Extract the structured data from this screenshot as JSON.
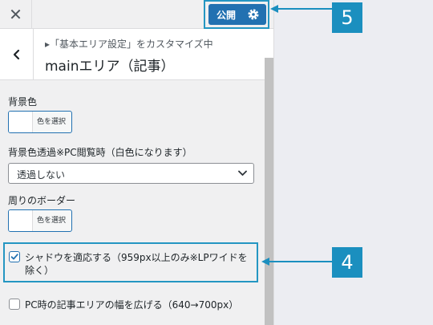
{
  "topbar": {
    "close_glyph": "✕",
    "publish_label": "公開"
  },
  "header": {
    "breadcrumb": "▸「基本エリア設定」をカスタマイズ中",
    "title": "mainエリア（記事）"
  },
  "controls": {
    "bg_color": {
      "label": "背景色",
      "button_label": "色を選択"
    },
    "transparency": {
      "label": "背景色透過※PC閲覧時（白色になります）",
      "value": "透過しない"
    },
    "border": {
      "label": "周りのボーダー",
      "button_label": "色を選択"
    },
    "shadow": {
      "label": "シャドウを適応する（959px以上のみ※LPワイドを除く）",
      "checked": true
    },
    "pc_width": {
      "label": "PC時の記事エリアの幅を広げる（640→700px）",
      "checked": false
    }
  },
  "annotations": {
    "callout_4": "4",
    "callout_5": "5"
  },
  "colors": {
    "accent": "#2271b1",
    "annotation": "#1b8fbf",
    "panel_bg": "#f0f0f1",
    "preview_bg": "#ecedf2"
  }
}
